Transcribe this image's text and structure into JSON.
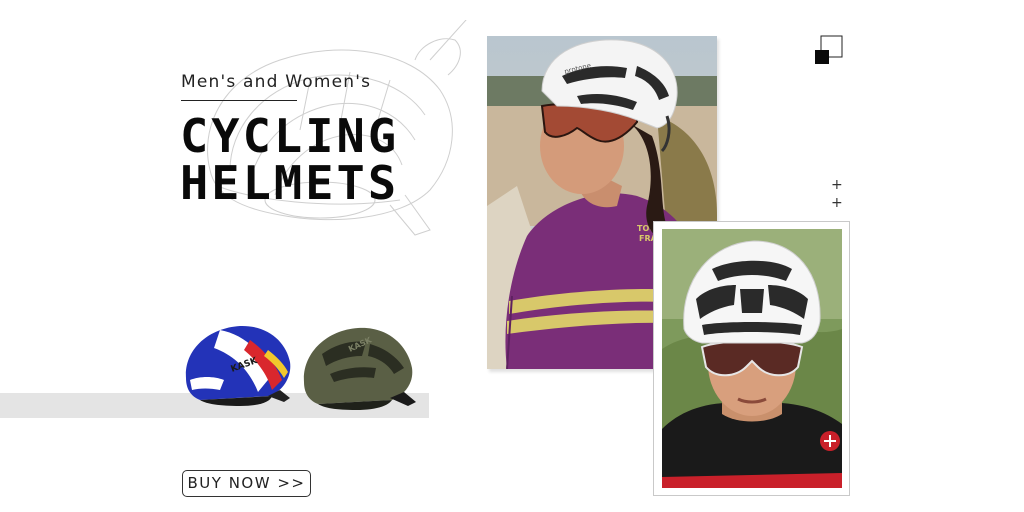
{
  "hero": {
    "subtitle": "Men's and Women's",
    "headline_line1": "CYCLING",
    "headline_line2": "HELMETS"
  },
  "cta": {
    "buy_label": "BUY NOW >>"
  },
  "decor": {
    "plus_top": "+",
    "plus_bottom": "+"
  },
  "photos": {
    "woman_jersey_text_1": "TOUR DE",
    "woman_jersey_text_2": "FRANC",
    "woman_helmet_brand": "protone"
  },
  "products": {
    "helmet_1_brand": "KASK",
    "helmet_2_brand": "KASK"
  },
  "colors": {
    "headline": "#0a0a0a",
    "shelf": "#e4e4e4",
    "jersey": "#7a2e78",
    "jersey_stripe": "#d8c86a",
    "olive_helmet": "#5a5f45",
    "color_helmet_blue": "#2333b8",
    "color_helmet_red": "#d9272d"
  }
}
